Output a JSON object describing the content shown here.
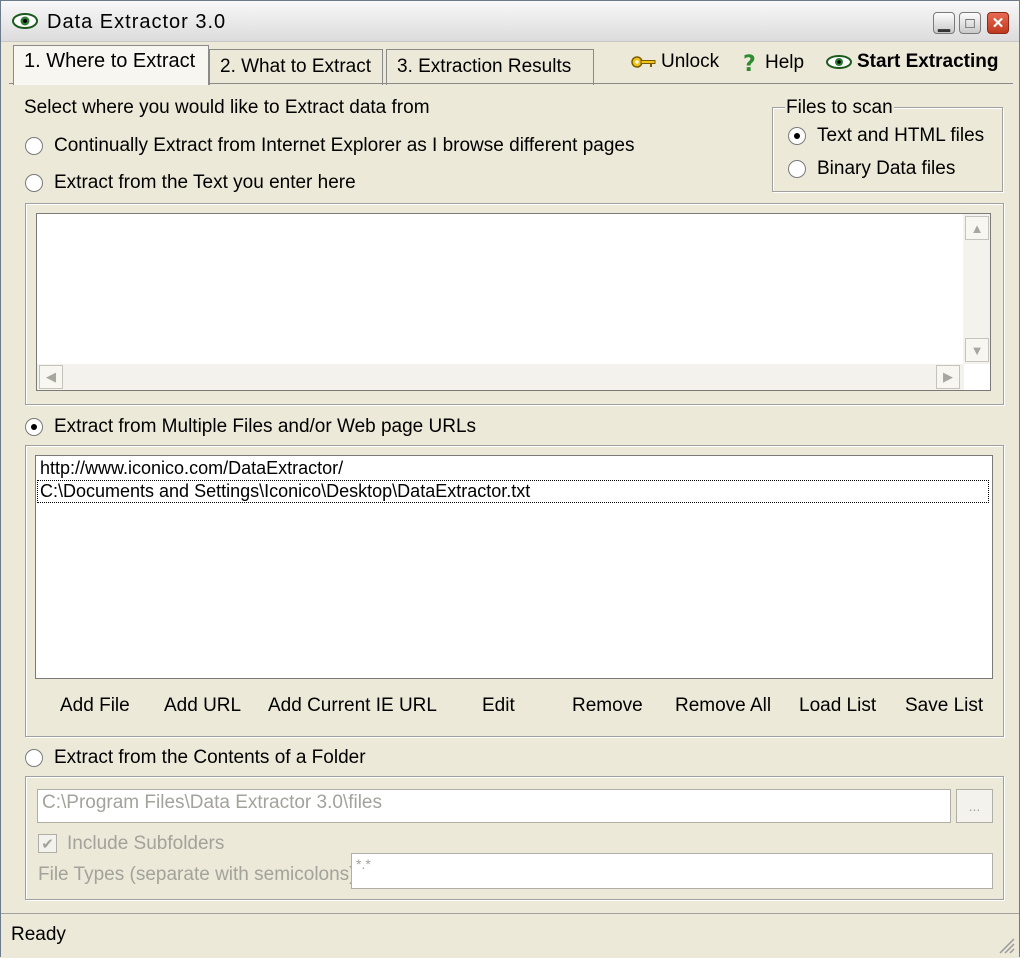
{
  "window": {
    "title": "Data Extractor 3.0",
    "icons": [
      "eye-icon",
      "minimize-icon",
      "maximize-icon",
      "close-icon"
    ]
  },
  "tabs": [
    {
      "label": "1. Where to Extract"
    },
    {
      "label": "2. What to Extract"
    },
    {
      "label": "3. Extraction Results"
    }
  ],
  "toolbar": {
    "unlock": "Unlock",
    "help": "Help",
    "start": "Start Extracting"
  },
  "source": {
    "heading": "Select where you would like to Extract data from",
    "option_ie": "Continually Extract from Internet Explorer as I browse different pages",
    "option_text": "Extract from the Text you enter here",
    "option_multi": "Extract from Multiple Files and/or Web page URLs",
    "option_folder": "Extract from the Contents of a Folder",
    "selected": "multi"
  },
  "files_to_scan": {
    "legend": "Files to scan",
    "text_html": "Text and HTML files",
    "binary": "Binary Data files",
    "selected": "text_html"
  },
  "textarea": {
    "value": ""
  },
  "url_list": {
    "items": [
      "http://www.iconico.com/DataExtractor/",
      "C:\\Documents and Settings\\Iconico\\Desktop\\DataExtractor.txt"
    ],
    "selected_index": 1
  },
  "list_buttons": {
    "add_file": "Add File",
    "add_url": "Add URL",
    "add_current_ie": "Add Current IE URL",
    "edit": "Edit",
    "remove": "Remove",
    "remove_all": "Remove All",
    "load_list": "Load List",
    "save_list": "Save List"
  },
  "folder": {
    "path": "C:\\Program Files\\Data Extractor 3.0\\files",
    "browse": "...",
    "include_subfolders": "Include Subfolders",
    "include_subfolders_checked": true,
    "file_types_label": "File Types (separate with semicolons)",
    "file_types_value": "*.*"
  },
  "status": {
    "text": "Ready"
  }
}
